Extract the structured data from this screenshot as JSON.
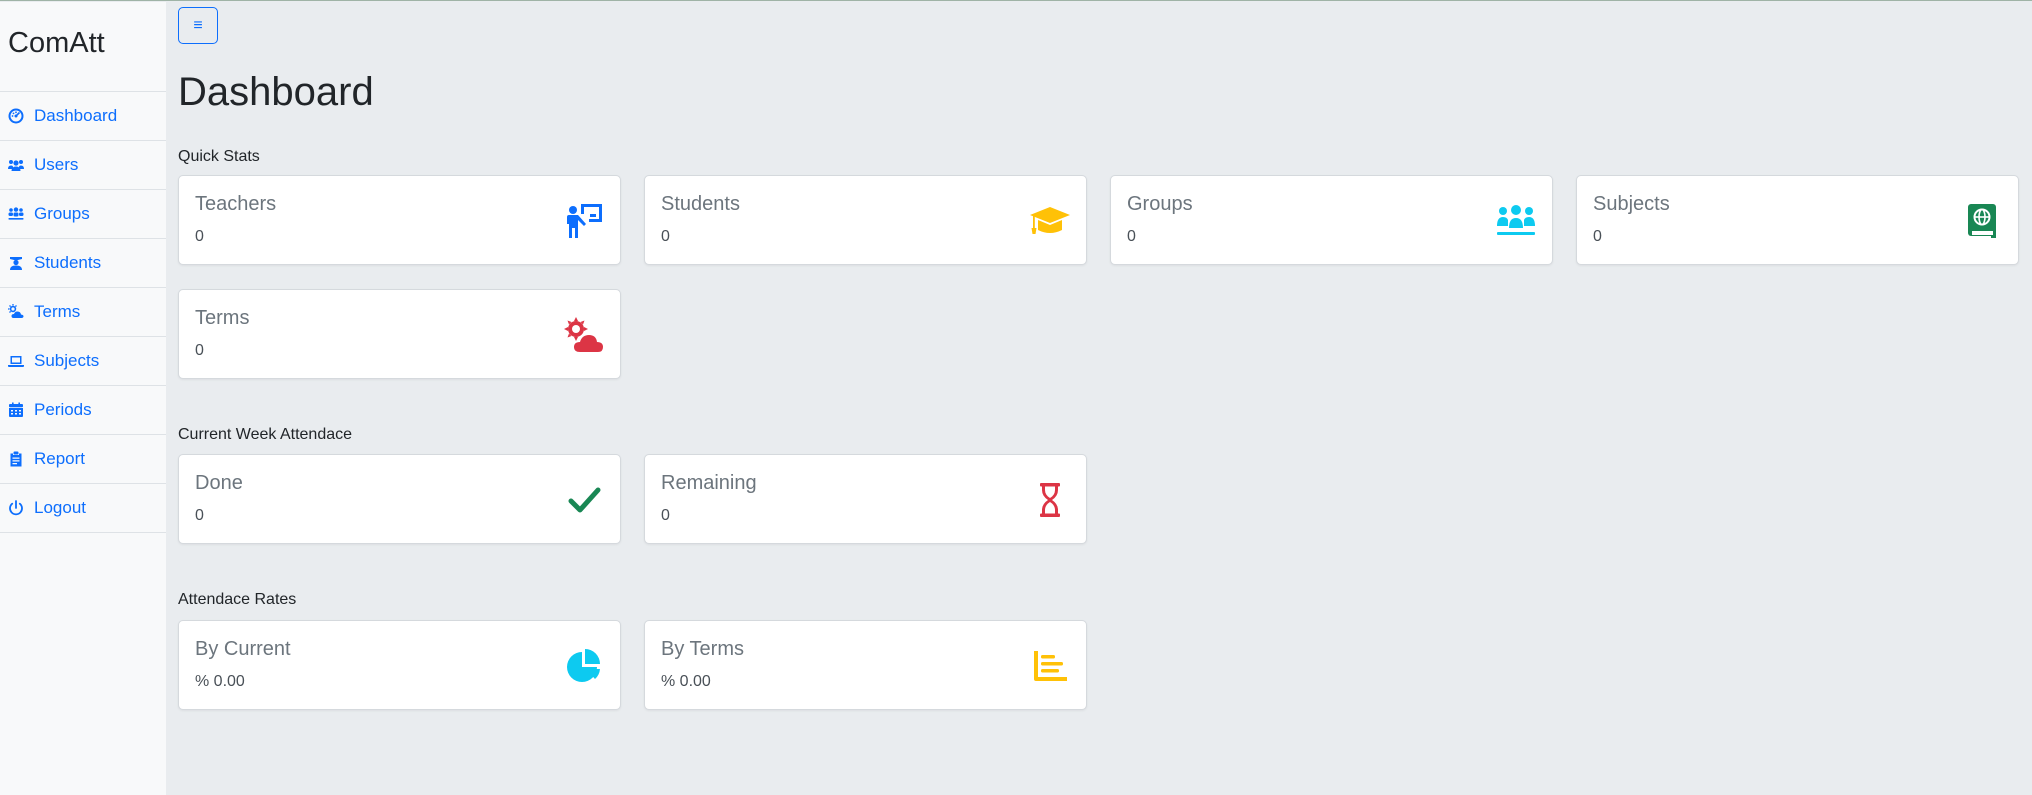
{
  "app": {
    "brand": "ComAtt"
  },
  "sidebar": {
    "items": [
      {
        "label": "Dashboard",
        "icon": "dashboard-gauge-icon"
      },
      {
        "label": "Users",
        "icon": "users-icon"
      },
      {
        "label": "Groups",
        "icon": "groups-icon"
      },
      {
        "label": "Students",
        "icon": "student-icon"
      },
      {
        "label": "Terms",
        "icon": "cloud-sun-icon"
      },
      {
        "label": "Subjects",
        "icon": "laptop-icon"
      },
      {
        "label": "Periods",
        "icon": "calendar-icon"
      },
      {
        "label": "Report",
        "icon": "clipboard-icon"
      },
      {
        "label": "Logout",
        "icon": "power-icon"
      }
    ]
  },
  "header": {
    "toggle_label": "≡",
    "title": "Dashboard"
  },
  "sections": {
    "quick_stats": {
      "label": "Quick Stats",
      "cards": [
        {
          "title": "Teachers",
          "value": "0",
          "icon": "chalkboard-teacher-icon",
          "color": "#0d6efd"
        },
        {
          "title": "Students",
          "value": "0",
          "icon": "graduation-cap-icon",
          "color": "#ffc107"
        },
        {
          "title": "Groups",
          "value": "0",
          "icon": "people-group-icon",
          "color": "#0dcaf0"
        },
        {
          "title": "Subjects",
          "value": "0",
          "icon": "book-atlas-icon",
          "color": "#198754"
        },
        {
          "title": "Terms",
          "value": "0",
          "icon": "cloud-sun-icon",
          "color": "#dc3545"
        }
      ]
    },
    "attendance_week": {
      "label": "Current Week Attendace",
      "cards": [
        {
          "title": "Done",
          "value": "0",
          "icon": "check-icon",
          "color": "#198754"
        },
        {
          "title": "Remaining",
          "value": "0",
          "icon": "hourglass-icon",
          "color": "#dc3545"
        }
      ]
    },
    "attendance_rates": {
      "label": "Attendace Rates",
      "cards": [
        {
          "title": "By Current",
          "value": "% 0.00",
          "icon": "pie-chart-icon",
          "color": "#0dcaf0"
        },
        {
          "title": "By Terms",
          "value": "% 0.00",
          "icon": "bar-chart-icon",
          "color": "#ffc107"
        }
      ]
    }
  }
}
